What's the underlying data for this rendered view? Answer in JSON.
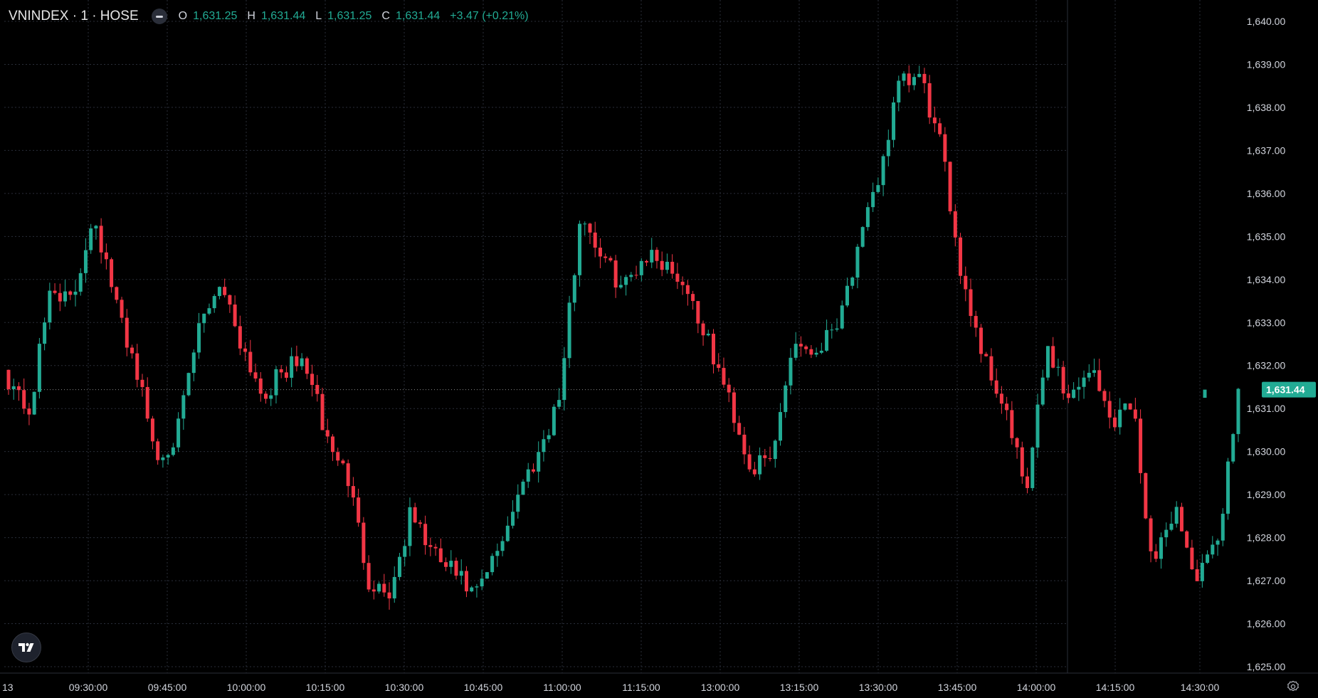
{
  "legend": {
    "symbol": "VNINDEX · 1 · HOSE",
    "o_label": "O",
    "o_value": "1,631.25",
    "h_label": "H",
    "h_value": "1,631.44",
    "l_label": "L",
    "l_value": "1,631.25",
    "c_label": "C",
    "c_value": "1,631.44",
    "change": "+3.47 (+0.21%)"
  },
  "colors": {
    "background": "#000000",
    "grid": "#2a2e39",
    "up": "#22ab94",
    "down": "#f23645",
    "text": "#d1d4dc",
    "last_price_bg": "#22ab94"
  },
  "icons": {
    "logo": "tradingview-logo-icon",
    "collapse": "minus-icon",
    "settings": "gear-icon"
  },
  "chart_data": {
    "type": "candlestick",
    "ylim": [
      1625,
      1640
    ],
    "y_ticks": [
      "1,640.00",
      "1,639.00",
      "1,638.00",
      "1,637.00",
      "1,636.00",
      "1,635.00",
      "1,634.00",
      "1,633.00",
      "1,632.00",
      "1,631.00",
      "1,630.00",
      "1,629.00",
      "1,628.00",
      "1,627.00",
      "1,626.00",
      "1,625.00"
    ],
    "y_tick_values": [
      1640,
      1639,
      1638,
      1637,
      1636,
      1635,
      1634,
      1633,
      1632,
      1631,
      1630,
      1629,
      1628,
      1627,
      1626,
      1625
    ],
    "x_ticks": [
      "13",
      "09:30:00",
      "09:45:00",
      "10:00:00",
      "10:15:00",
      "10:30:00",
      "10:45:00",
      "11:00:00",
      "11:15:00",
      "13:00:00",
      "13:15:00",
      "13:30:00",
      "13:45:00",
      "14:00:00",
      "14:15:00",
      "14:30:00"
    ],
    "last_price_label": "1,631.44",
    "last_price": 1631.44,
    "waypoints": [
      1631.7,
      1630.9,
      1633.9,
      1633.4,
      1635.6,
      1633.5,
      1632.0,
      1629.8,
      1630.5,
      1632.9,
      1634.0,
      1632.5,
      1631.3,
      1631.9,
      1632.1,
      1630.3,
      1629.4,
      1627.0,
      1626.7,
      1628.6,
      1627.6,
      1627.2,
      1626.6,
      1627.6,
      1629.0,
      1630.0,
      1631.3,
      1635.6,
      1634.5,
      1633.8,
      1634.6,
      1634.4,
      1633.8,
      1632.5,
      1631.2,
      1629.6,
      1629.8,
      1632.6,
      1632.3,
      1633.0,
      1634.5,
      1636.3,
      1638.5,
      1638.7,
      1637.0,
      1634.0,
      1632.2,
      1631.0,
      1629.0,
      1632.5,
      1631.2,
      1632.0,
      1630.7,
      1631.2,
      1627.2,
      1628.8,
      1627.0,
      1627.8,
      1631.4
    ],
    "candle_count": 240
  }
}
